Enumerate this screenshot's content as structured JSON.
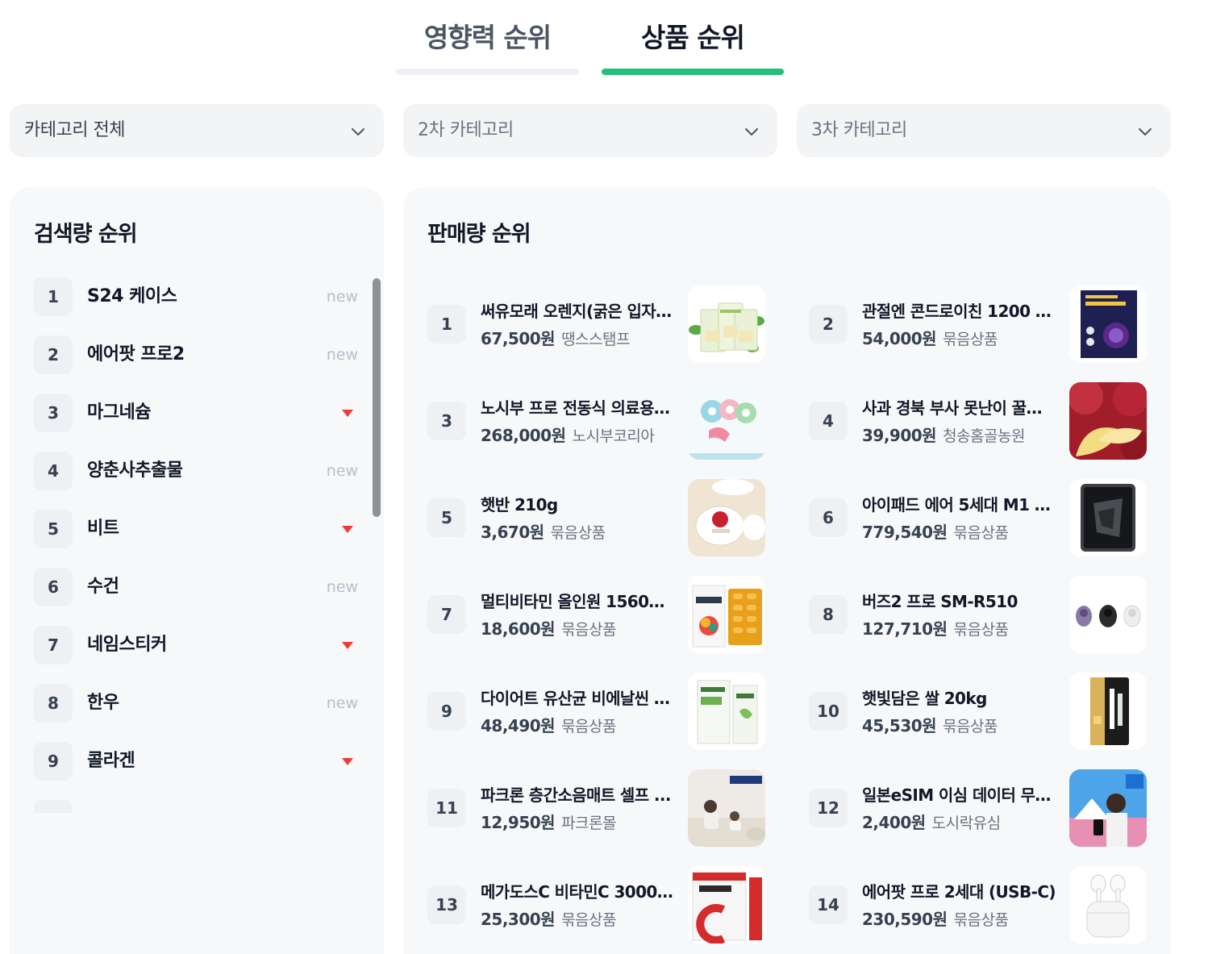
{
  "tabs": [
    {
      "label": "영향력 순위",
      "active": false
    },
    {
      "label": "상품 순위",
      "active": true
    }
  ],
  "filters": [
    {
      "value": "카테고리 전체",
      "placeholder": false
    },
    {
      "value": "2차 카테고리",
      "placeholder": true
    },
    {
      "value": "3차 카테고리",
      "placeholder": true
    }
  ],
  "search_panel": {
    "title": "검색량 순위",
    "items": [
      {
        "rank": "1",
        "keyword": "S24 케이스",
        "status": "new"
      },
      {
        "rank": "2",
        "keyword": "에어팟 프로2",
        "status": "new"
      },
      {
        "rank": "3",
        "keyword": "마그네슘",
        "status": "down"
      },
      {
        "rank": "4",
        "keyword": "양춘사추출물",
        "status": "new"
      },
      {
        "rank": "5",
        "keyword": "비트",
        "status": "down"
      },
      {
        "rank": "6",
        "keyword": "수건",
        "status": "new"
      },
      {
        "rank": "7",
        "keyword": "네임스티커",
        "status": "down"
      },
      {
        "rank": "8",
        "keyword": "한우",
        "status": "new"
      },
      {
        "rank": "9",
        "keyword": "콜라겐",
        "status": "down"
      }
    ]
  },
  "sales_panel": {
    "title": "판매량 순위",
    "items": [
      {
        "rank": "1",
        "name": "써유모래 오렌지(굵은 입자)...",
        "price": "67,500원",
        "seller": "땡스스탬프",
        "icon": "sand-bags-thumbnail"
      },
      {
        "rank": "2",
        "name": "관절엔 콘드로이친 1200 9...",
        "price": "54,000원",
        "seller": "묶음상품",
        "icon": "supplement-box-thumbnail"
      },
      {
        "rank": "3",
        "name": "노시부 프로 전동식 의료용 ...",
        "price": "268,000원",
        "seller": "노시부코리아",
        "icon": "nasal-aspirator-thumbnail"
      },
      {
        "rank": "4",
        "name": "사과 경북 부사 못난이 꿀사...",
        "price": "39,900원",
        "seller": "청송홈골농원",
        "icon": "apple-thumbnail"
      },
      {
        "rank": "5",
        "name": "햇반 210g",
        "price": "3,670원",
        "seller": "묶음상품",
        "icon": "rice-bowl-thumbnail"
      },
      {
        "rank": "6",
        "name": "아이패드 에어 5세대 M1 W...",
        "price": "779,540원",
        "seller": "묶음상품",
        "icon": "tablet-thumbnail"
      },
      {
        "rank": "7",
        "name": "멀티비타민 올인원 1560m...",
        "price": "18,600원",
        "seller": "묶음상품",
        "icon": "vitamin-pack-thumbnail"
      },
      {
        "rank": "8",
        "name": "버즈2 프로 SM-R510",
        "price": "127,710원",
        "seller": "묶음상품",
        "icon": "earbuds-thumbnail"
      },
      {
        "rank": "9",
        "name": "다이어트 유산균 비에날씬 4...",
        "price": "48,490원",
        "seller": "묶음상품",
        "icon": "probiotic-box-thumbnail"
      },
      {
        "rank": "10",
        "name": "햇빛담은 쌀 20kg",
        "price": "45,530원",
        "seller": "묶음상품",
        "icon": "rice-bag-thumbnail"
      },
      {
        "rank": "11",
        "name": "파크론 층간소음매트 셀프 ...",
        "price": "12,950원",
        "seller": "파크론몰",
        "icon": "floor-mat-thumbnail"
      },
      {
        "rank": "12",
        "name": "일본eSIM 이심 데이터 무제...",
        "price": "2,400원",
        "seller": "도시락유심",
        "icon": "esim-promo-thumbnail"
      },
      {
        "rank": "13",
        "name": "메가도스C 비타민C 3000 ...",
        "price": "25,300원",
        "seller": "묶음상품",
        "icon": "vitamin-c-box-thumbnail"
      },
      {
        "rank": "14",
        "name": "에어팟 프로 2세대 (USB-C)",
        "price": "230,590원",
        "seller": "묶음상품",
        "icon": "airpods-thumbnail"
      }
    ]
  },
  "colors": {
    "accent": "#25bf7c",
    "down": "#ef3b36",
    "panel_bg": "#f7f8fa",
    "rank_bg": "#eef0f3"
  }
}
